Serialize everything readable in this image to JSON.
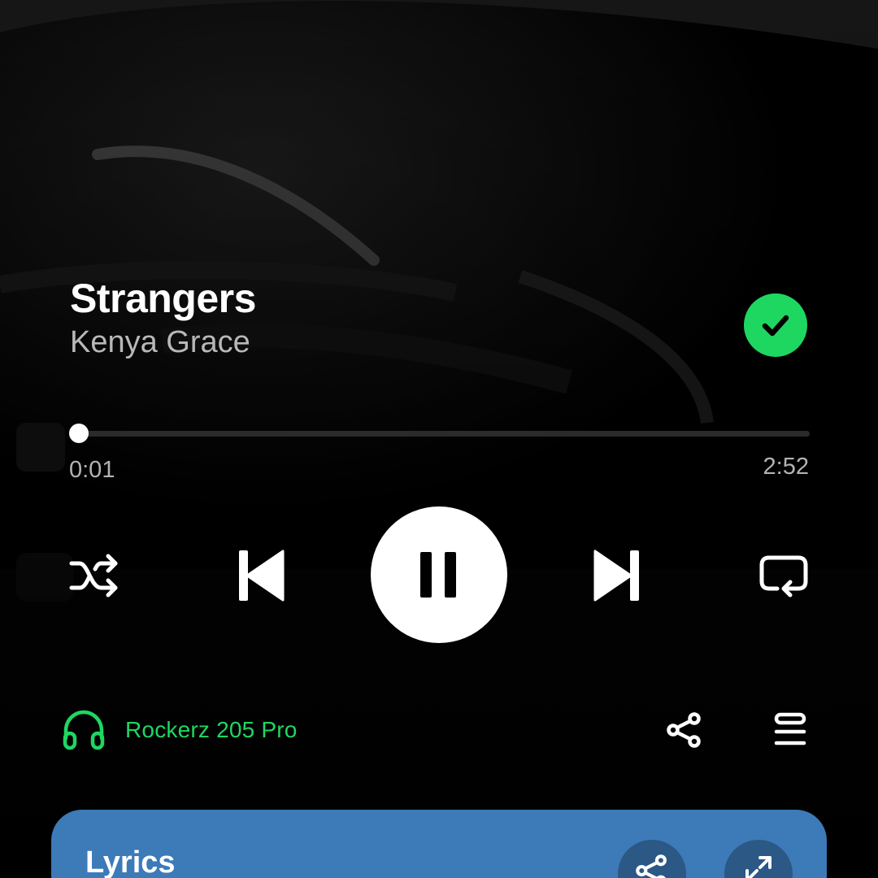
{
  "track": {
    "title": "Strangers",
    "artist": "Kenya Grace",
    "liked": true
  },
  "playback": {
    "elapsed": "0:01",
    "duration": "2:52",
    "progress_fraction": 0.006,
    "state": "playing"
  },
  "device": {
    "name": "Rockerz 205 Pro",
    "icon": "headphones-icon"
  },
  "lyrics": {
    "title": "Lyrics"
  },
  "colors": {
    "accent": "#1ed760",
    "lyrics_card": "#3c7ab8",
    "background": "#000000"
  }
}
